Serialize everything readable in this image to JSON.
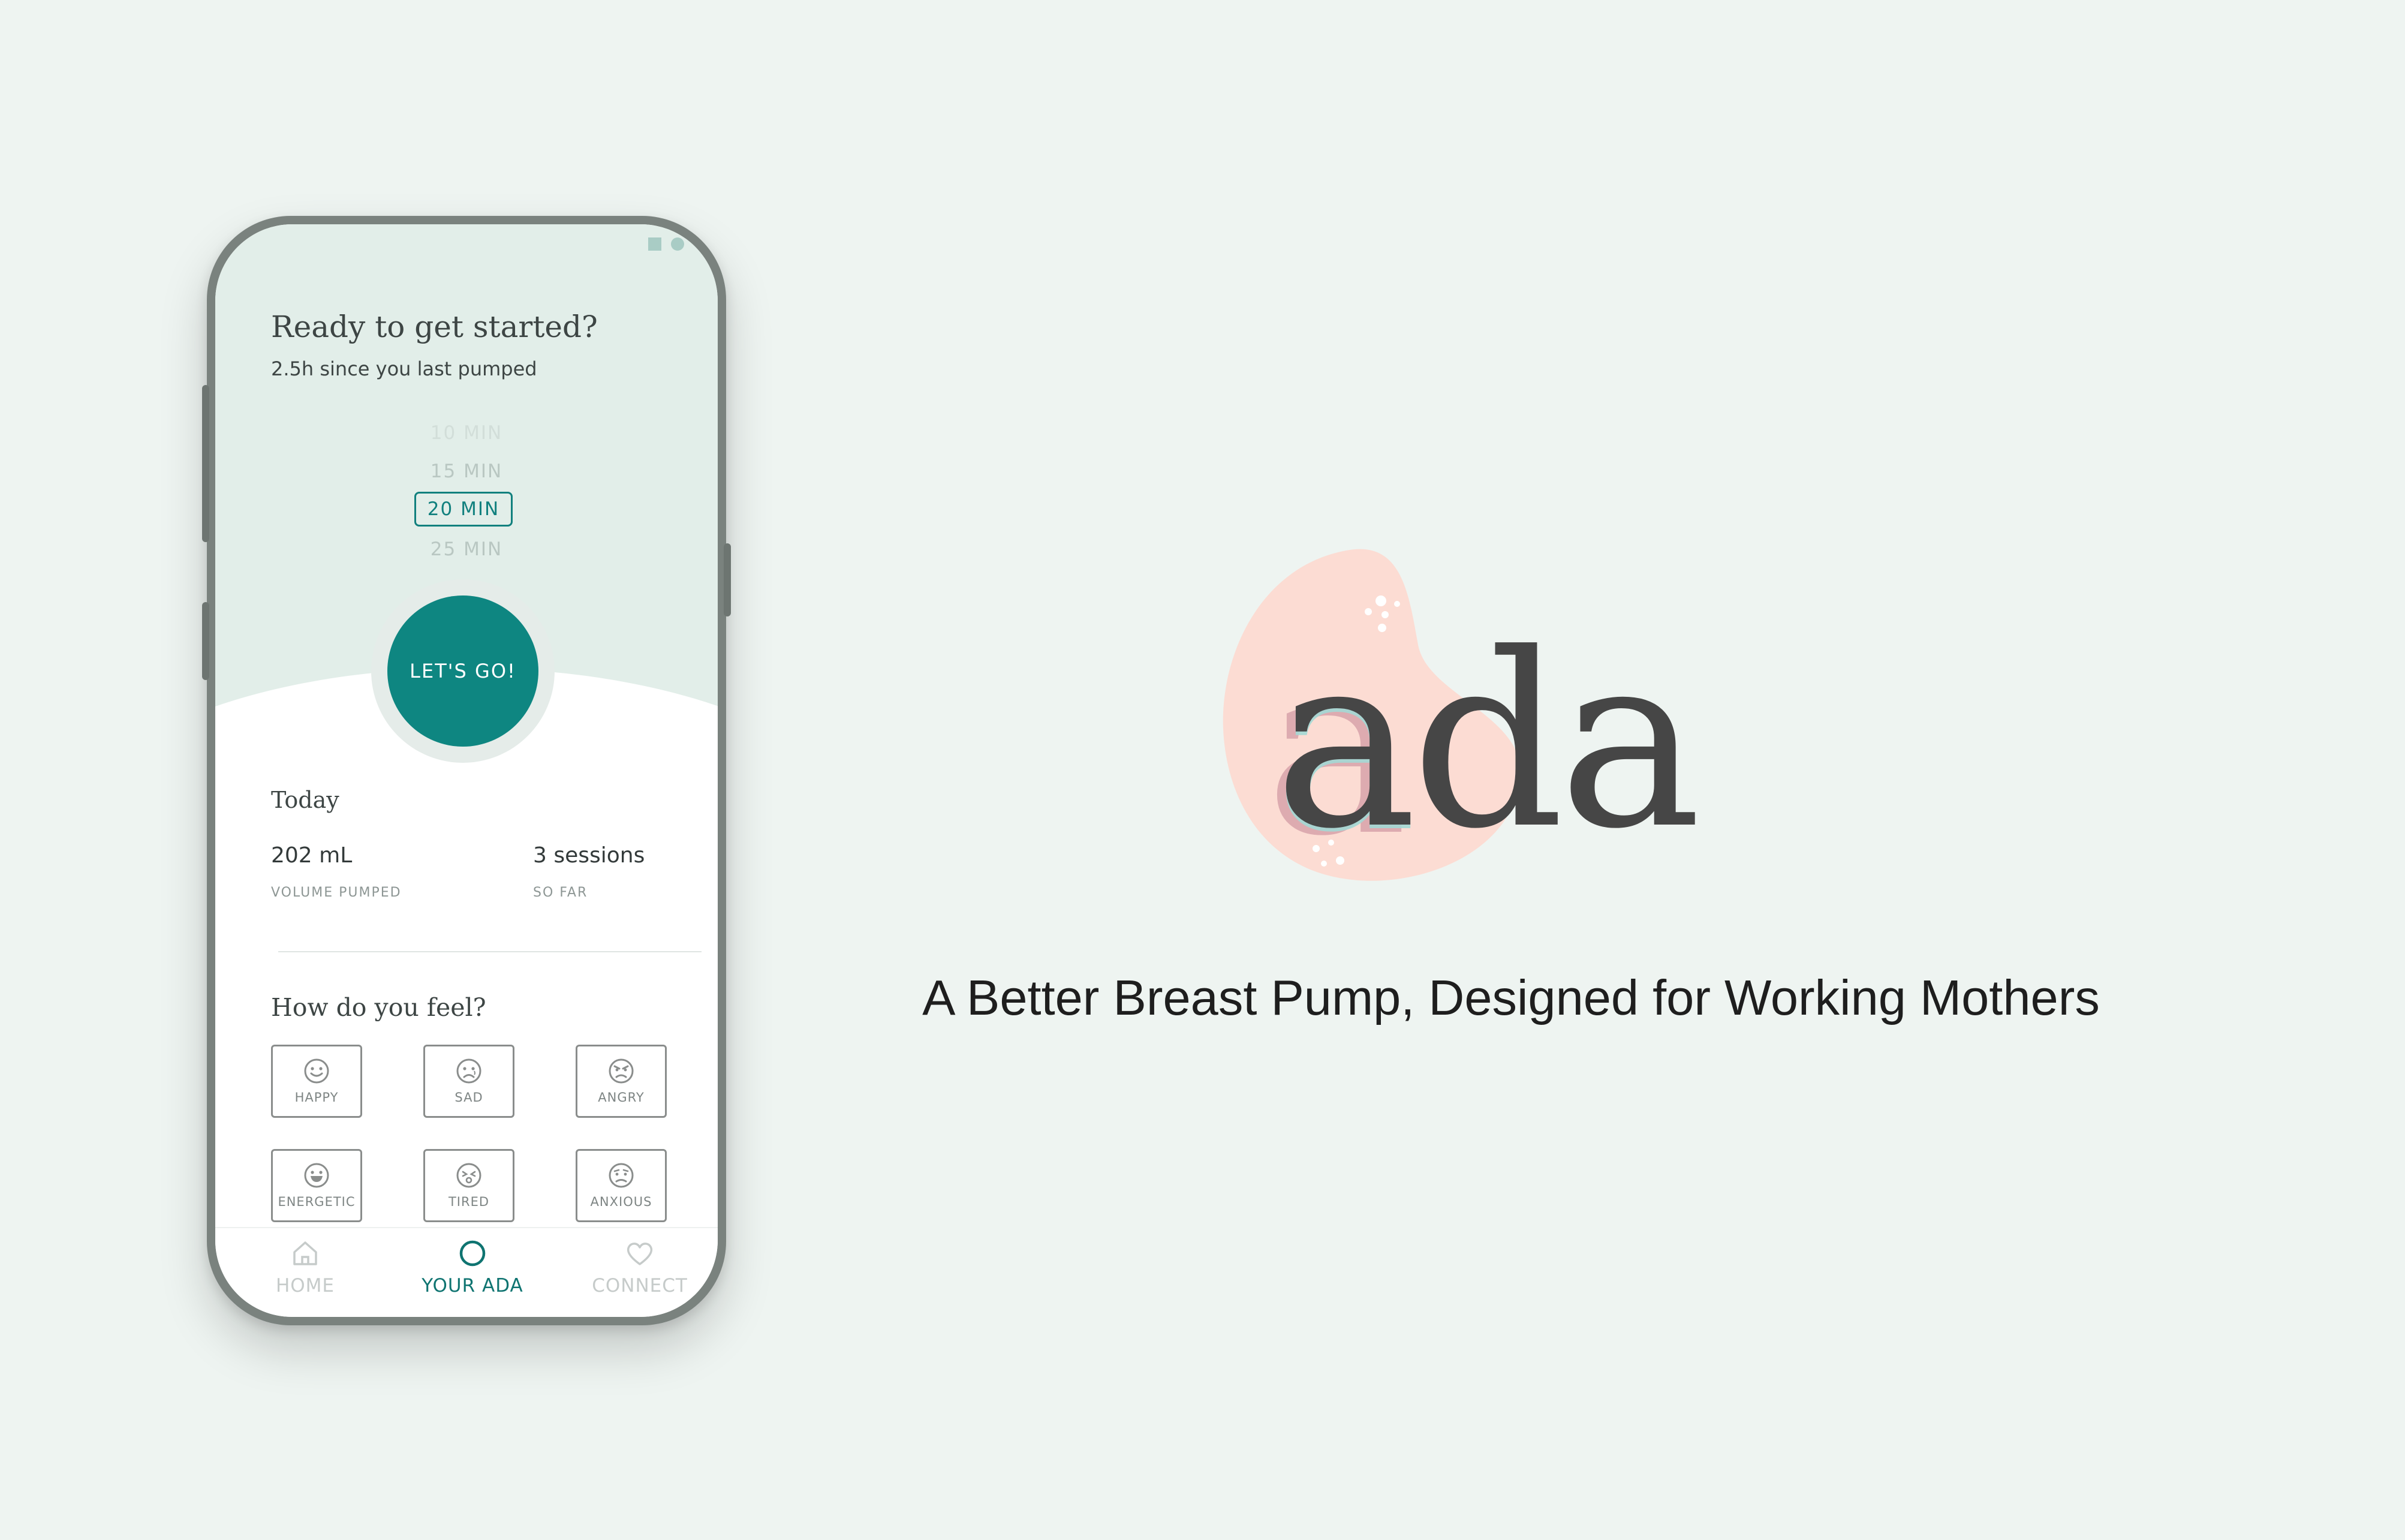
{
  "app": {
    "greeting": "Ready to get started?",
    "since_last": "2.5h since you last pumped",
    "timer_options": [
      "10 MIN",
      "15 MIN",
      "20 MIN",
      "25 MIN"
    ],
    "selected_timer": "20 MIN",
    "start_label": "LET'S GO!",
    "today": {
      "title": "Today",
      "volume_value": "202 mL",
      "volume_label": "VOLUME PUMPED",
      "sessions_value": "3 sessions",
      "sessions_label": "SO FAR"
    },
    "feel": {
      "title": "How do you feel?",
      "moods": [
        {
          "label": "HAPPY",
          "icon": "smile-icon"
        },
        {
          "label": "SAD",
          "icon": "sad-face-icon"
        },
        {
          "label": "ANGRY",
          "icon": "angry-face-icon"
        },
        {
          "label": "ENERGETIC",
          "icon": "grin-icon"
        },
        {
          "label": "TIRED",
          "icon": "tired-face-icon"
        },
        {
          "label": "ANXIOUS",
          "icon": "anxious-face-icon"
        }
      ]
    },
    "nav": {
      "home": "HOME",
      "your_ada": "YOUR ADA",
      "connect": "CONNECT",
      "active": "YOUR ADA"
    }
  },
  "brand": {
    "logo_text": "ada",
    "tagline": "A Better Breast Pump, Designed for Working Mothers"
  },
  "colors": {
    "background": "#eef4f1",
    "accent": "#0e8681",
    "screen_top": "#e2eee9",
    "logo_blob": "#fcdcd3",
    "logo_text": "#464646"
  }
}
